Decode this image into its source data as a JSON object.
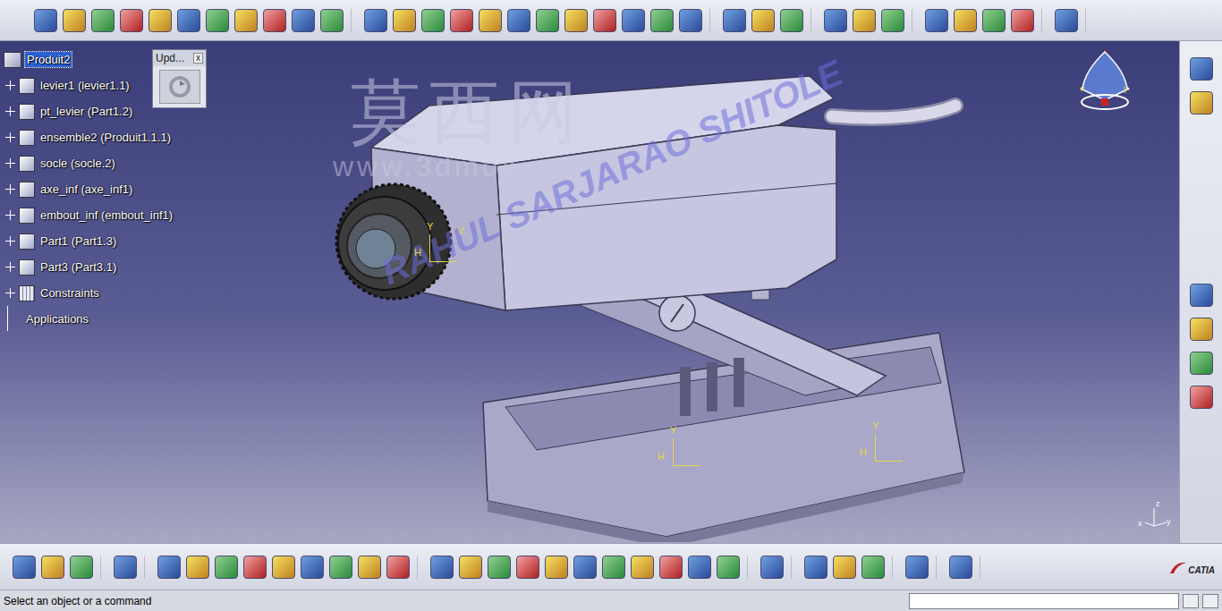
{
  "tree": {
    "root": {
      "label": "Produit2",
      "selected": true
    },
    "items": [
      {
        "label": "levier1 (levier1.1)",
        "kind": "part",
        "expanded": false
      },
      {
        "label": "pt_levier (Part1.2)",
        "kind": "part",
        "expanded": false
      },
      {
        "label": "ensemble2 (Produit1.1.1)",
        "kind": "part",
        "expanded": false
      },
      {
        "label": "socle (socle.2)",
        "kind": "part",
        "expanded": false
      },
      {
        "label": "axe_inf (axe_inf1)",
        "kind": "part",
        "expanded": false
      },
      {
        "label": "embout_inf (embout_inf1)",
        "kind": "part",
        "expanded": false
      },
      {
        "label": "Part1 (Part1.3)",
        "kind": "part",
        "expanded": false
      },
      {
        "label": "Part3 (Part3.1)",
        "kind": "part",
        "expanded": false
      },
      {
        "label": "Constraints",
        "kind": "constraints",
        "expanded": false
      }
    ],
    "footer": "Applications"
  },
  "update_dialog": {
    "title": "Upd...",
    "close": "x"
  },
  "watermarks": {
    "site_name": "莫西网",
    "site_url": "www.3dmox.com",
    "author": "RAHUL SARJARAO SHITOLE"
  },
  "compass_labels": [
    "x",
    "y"
  ],
  "sketch_axes": [
    {
      "v": "Y",
      "h": "H",
      "extra": "V"
    },
    {
      "v": "Y",
      "h": "H",
      "extra": ""
    },
    {
      "v": "Y",
      "h": "H",
      "extra": ""
    }
  ],
  "corner_axis_labels": [
    "z",
    "x",
    "y"
  ],
  "logo": {
    "brand": "CATIA"
  },
  "status_bar": {
    "message": "Select an object or a command",
    "input": ""
  }
}
